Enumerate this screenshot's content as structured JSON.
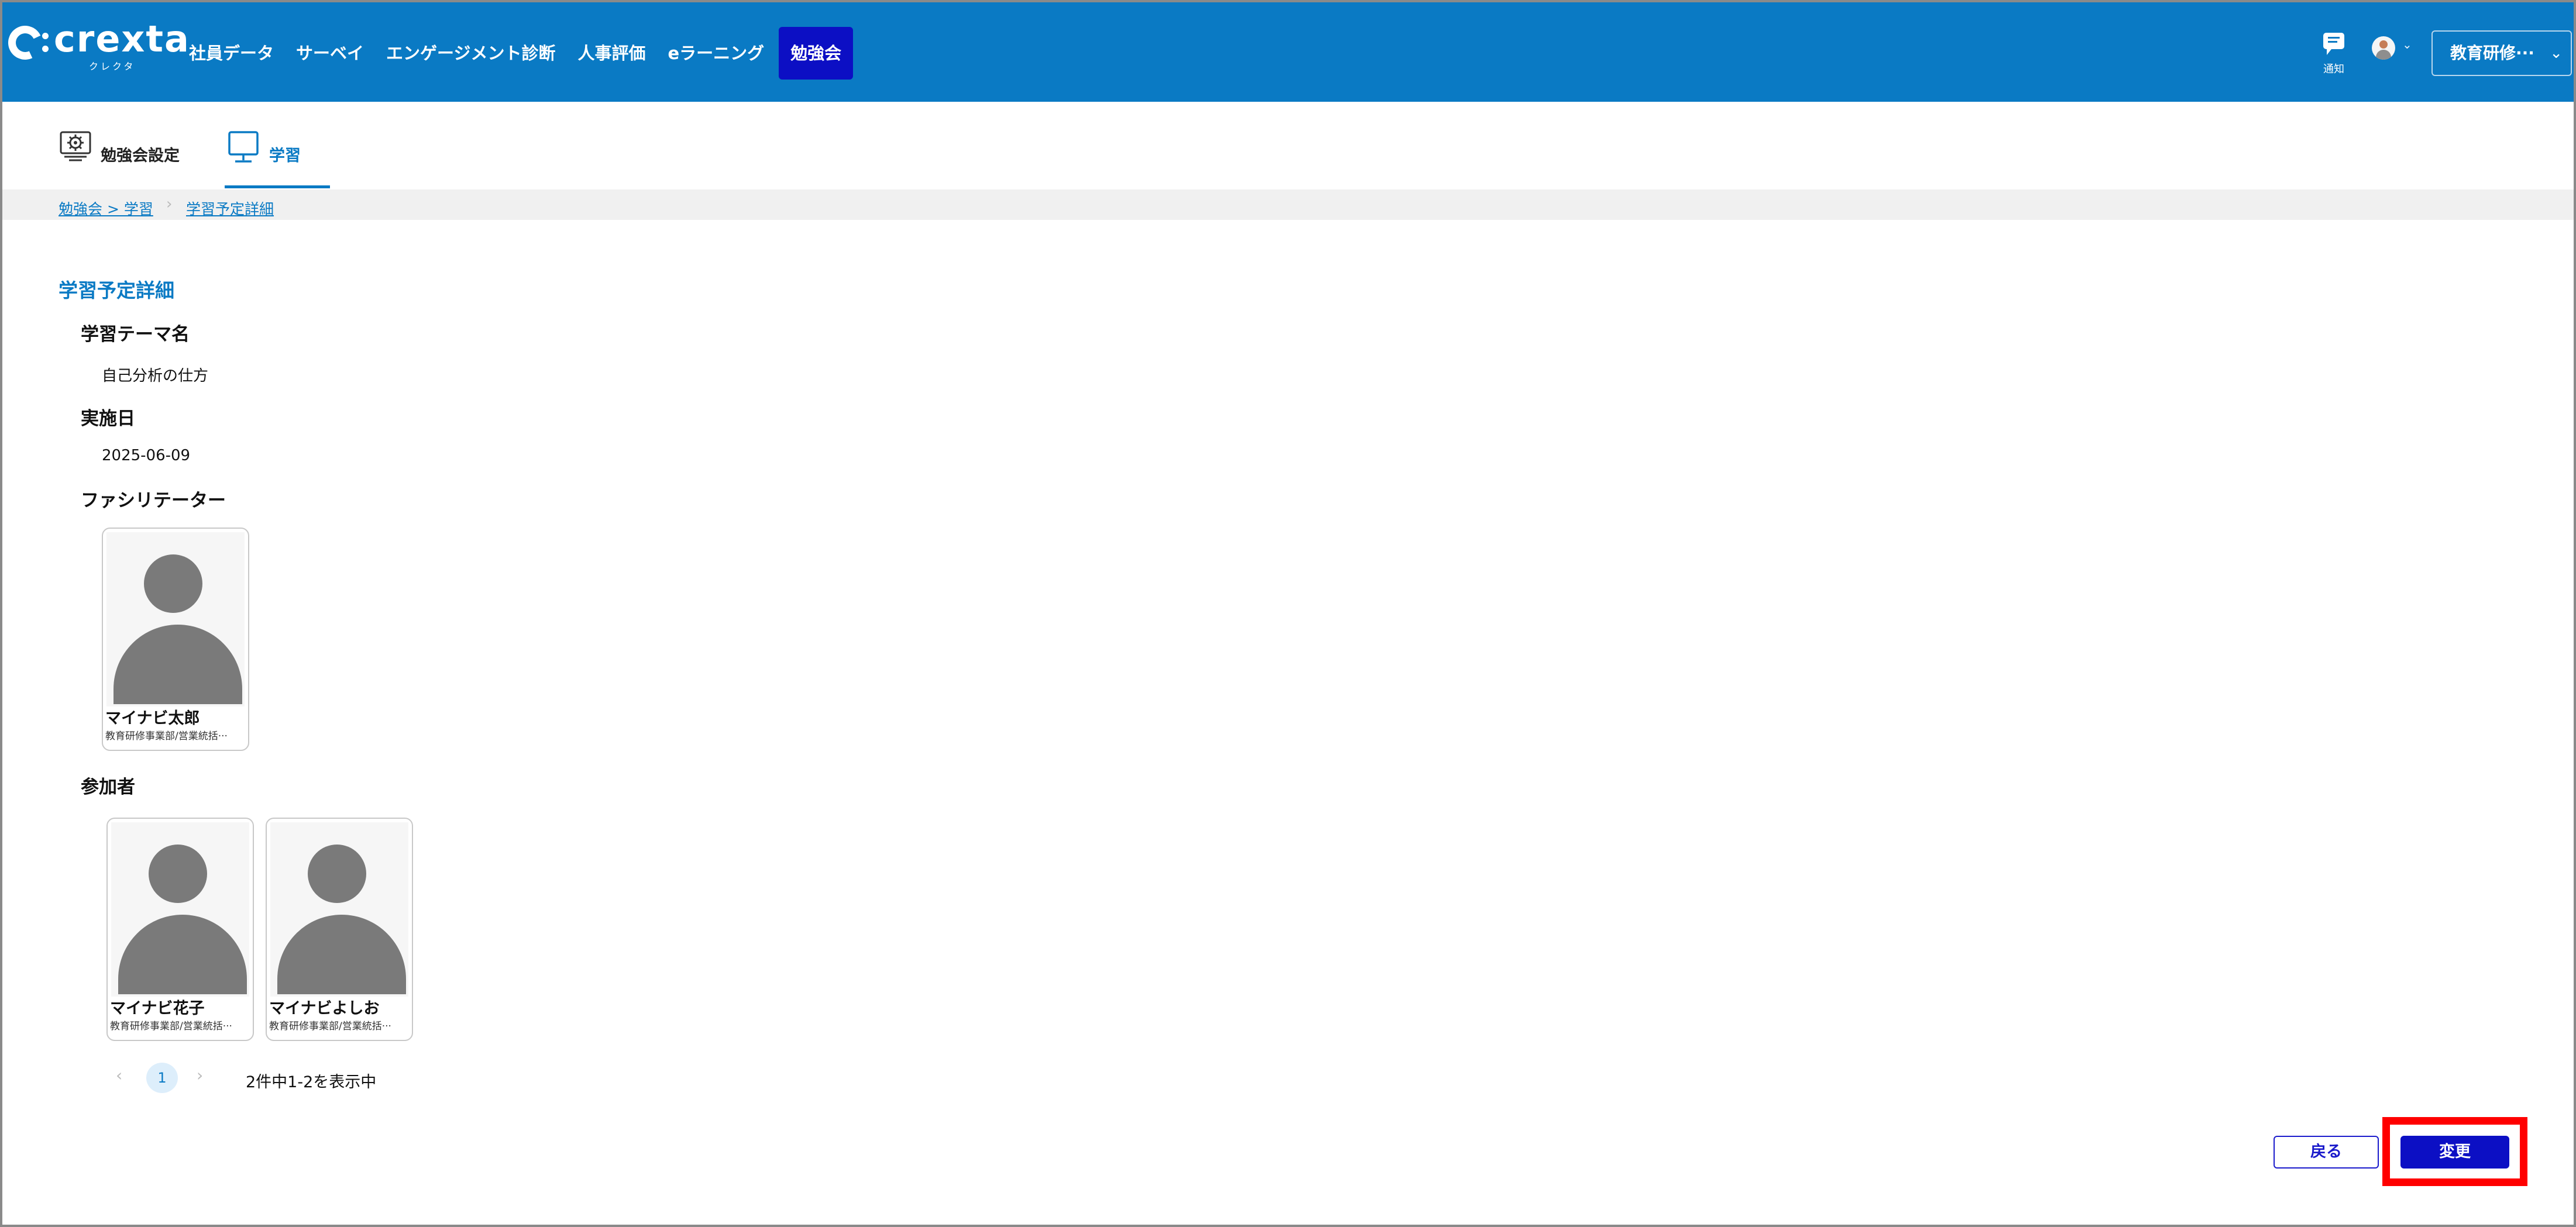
{
  "app": {
    "logo_text": "crexta",
    "logo_subtext": "クレクタ"
  },
  "nav": {
    "items": [
      {
        "label": "社員データ"
      },
      {
        "label": "サーベイ"
      },
      {
        "label": "エンゲージメント診断"
      },
      {
        "label": "人事評価"
      },
      {
        "label": "eラーニング"
      },
      {
        "label": "勉強会",
        "active": true
      }
    ],
    "notify_label": "通知",
    "org_select_value": "教育研修···"
  },
  "tabs": [
    {
      "label": "勉強会設定",
      "icon": "gear-icon"
    },
    {
      "label": "学習",
      "icon": "monitor-icon",
      "active": true
    }
  ],
  "breadcrumb": {
    "items": [
      "勉強会 > 学習",
      "学習予定詳細"
    ]
  },
  "detail": {
    "section_title": "学習予定詳細",
    "theme_label": "学習テーマ名",
    "theme_value": "自己分析の仕方",
    "date_label": "実施日",
    "date_value": "2025-06-09",
    "facilitator_label": "ファシリテーター",
    "facilitator": {
      "name": "マイナビ太郎",
      "dept": "教育研修事業部/営業統括···"
    },
    "participants_label": "参加者",
    "participants": [
      {
        "name": "マイナビ花子",
        "dept": "教育研修事業部/営業統括···"
      },
      {
        "name": "マイナビよしお",
        "dept": "教育研修事業部/営業統括···"
      }
    ]
  },
  "pagination": {
    "current_page": "1",
    "info": "2件中1-2を表示中"
  },
  "actions": {
    "back_label": "戻る",
    "change_label": "変更"
  },
  "colors": {
    "header": "#0a7ac4",
    "active_nav": "#0c0fc4",
    "primary_button": "#0c0fc4",
    "highlight": "#ff0000"
  }
}
